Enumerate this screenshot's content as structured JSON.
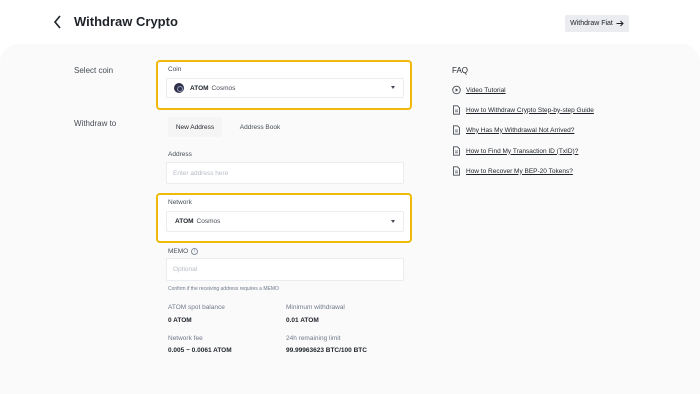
{
  "header": {
    "title": "Withdraw Crypto",
    "back_icon": "chevron-left-icon",
    "withdraw_fiat_label": "Withdraw Fiat",
    "withdraw_fiat_icon": "arrow-right-icon"
  },
  "form": {
    "select_coin_label": "Select coin",
    "coin": {
      "label": "Coin",
      "symbol": "ATOM",
      "name": "Cosmos",
      "icon": "cosmos-coin-icon"
    },
    "withdraw_to_label": "Withdraw to",
    "tabs": [
      {
        "label": "New Address",
        "active": true
      },
      {
        "label": "Address Book",
        "active": false
      }
    ],
    "address": {
      "label": "Address",
      "placeholder": "Enter address here"
    },
    "network": {
      "label": "Network",
      "symbol": "ATOM",
      "name": "Cosmos"
    },
    "memo": {
      "label": "MEMO",
      "info_icon": "info-icon",
      "placeholder": "Optional",
      "hint": "Confirm if the receiving address requires a MEMO"
    },
    "stats": {
      "spot_balance_label": "ATOM spot balance",
      "spot_balance_value": "0 ATOM",
      "min_withdrawal_label": "Minimum withdrawal",
      "min_withdrawal_value": "0.01 ATOM",
      "network_fee_label": "Network fee",
      "network_fee_value": "0.005 ~ 0.0061 ATOM",
      "remaining_limit_label": "24h remaining limit",
      "remaining_limit_value": "99.99963623 BTC/100 BTC"
    },
    "highlight_color": "#f0b90b"
  },
  "faq": {
    "title": "FAQ",
    "items": [
      {
        "label": "Video Tutorial",
        "icon": "play-circle-icon"
      },
      {
        "label": "How to Withdraw Crypto Step-by-step Guide",
        "icon": "document-icon"
      },
      {
        "label": "Why Has My Withdrawal Not Arrived?",
        "icon": "document-icon"
      },
      {
        "label": "How to Find My Transaction ID (TxID)?",
        "icon": "document-icon"
      },
      {
        "label": "How to Recover My BEP-20 Tokens?",
        "icon": "document-icon"
      }
    ]
  }
}
